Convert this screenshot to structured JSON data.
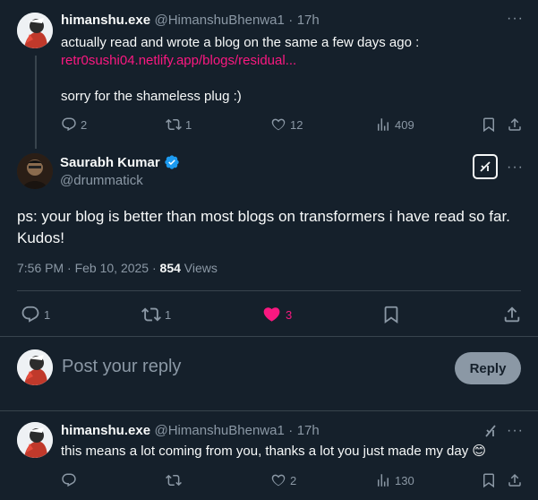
{
  "tweet1": {
    "name": "himanshu.exe",
    "handle": "@HimanshuBhenwa1",
    "time": "17h",
    "text_line1": "actually read and wrote a blog on the same a few days ago :",
    "link": "retr0sushi04.netlify.app/blogs/residual...",
    "text_line3": "sorry for the shameless plug :)",
    "replies": "2",
    "reposts": "1",
    "likes": "12",
    "views": "409"
  },
  "main_tweet": {
    "name": "Saurabh Kumar",
    "handle": "@drummatick",
    "text": "ps: your blog is better than most blogs on transformers i have read so far. Kudos!",
    "time": "7:56 PM · Feb 10, 2025 · ",
    "views_count": "854",
    "views_label": " Views",
    "replies": "1",
    "reposts": "1",
    "likes": "3",
    "like_color": "#f91880"
  },
  "reply_box": {
    "placeholder": "Post your reply",
    "button_label": "Reply"
  },
  "tweet3": {
    "name": "himanshu.exe",
    "handle": "@HimanshuBhenwa1",
    "time": "17h",
    "text": "this means a lot coming from you, thanks a lot you just made my day 😊",
    "replies": "",
    "reposts": "",
    "likes": "2",
    "views": "130"
  },
  "colors": {
    "background": "#15202b",
    "muted": "#8b98a5",
    "verified": "#1d9bf0",
    "link": "#f91880"
  }
}
